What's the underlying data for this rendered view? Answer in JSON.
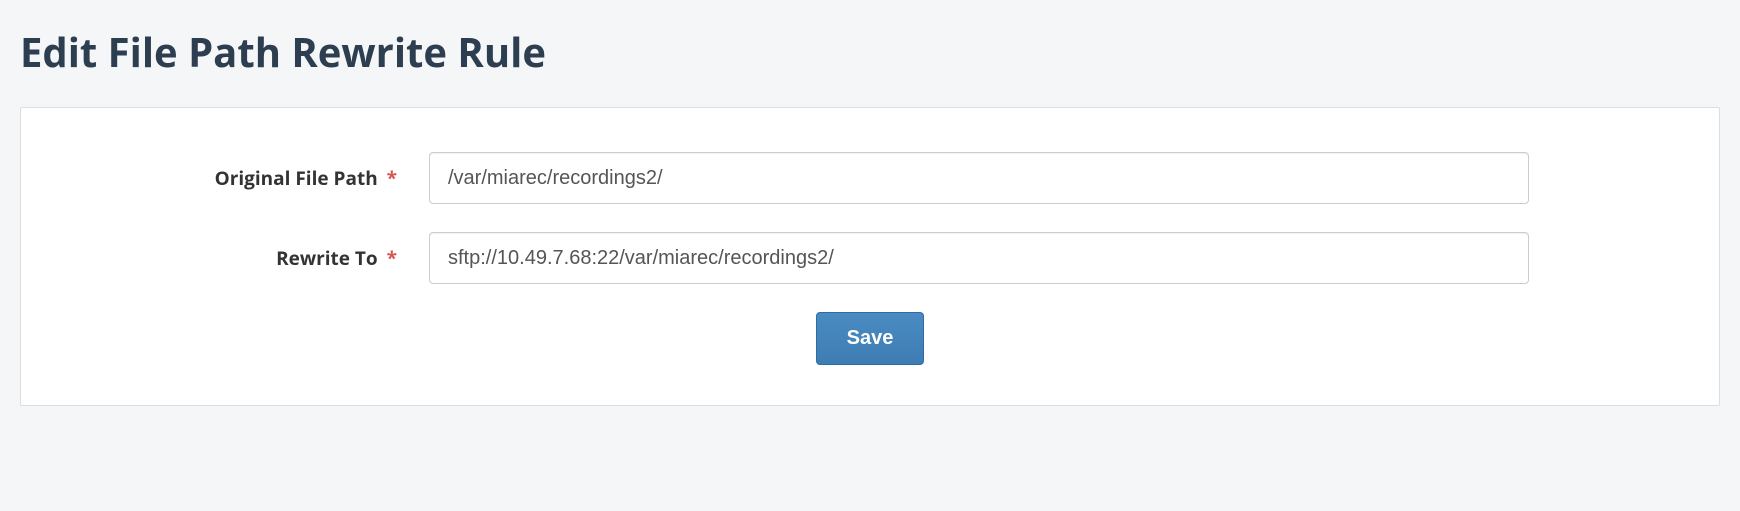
{
  "page": {
    "title": "Edit File Path Rewrite Rule"
  },
  "form": {
    "fields": {
      "original_path": {
        "label": "Original File Path",
        "required_mark": "*",
        "value": "/var/miarec/recordings2/"
      },
      "rewrite_to": {
        "label": "Rewrite To",
        "required_mark": "*",
        "value": "sftp://10.49.7.68:22/var/miarec/recordings2/"
      }
    },
    "buttons": {
      "save": "Save"
    }
  }
}
